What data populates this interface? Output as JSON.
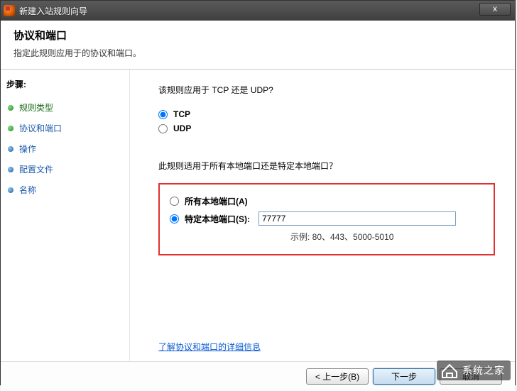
{
  "titlebar": {
    "text": "新建入站规则向导",
    "close": "x"
  },
  "header": {
    "title": "协议和端口",
    "subtitle": "指定此规则应用于的协议和端口。"
  },
  "sidebar": {
    "steps_label": "步骤:",
    "items": [
      {
        "label": "规则类型",
        "status": "completed"
      },
      {
        "label": "协议和端口",
        "status": "current"
      },
      {
        "label": "操作",
        "status": "pending"
      },
      {
        "label": "配置文件",
        "status": "pending"
      },
      {
        "label": "名称",
        "status": "pending"
      }
    ]
  },
  "content": {
    "protocol_question": "该规则应用于 TCP 还是 UDP?",
    "tcp_label": "TCP",
    "udp_label": "UDP",
    "protocol_selected": "tcp",
    "port_question": "此规则适用于所有本地端口还是特定本地端口？",
    "all_ports_label": "所有本地端口(A)",
    "specific_ports_label": "特定本地端口(S):",
    "port_selected": "specific",
    "port_value": "77777",
    "port_example": "示例: 80、443、5000-5010",
    "learn_link": "了解协议和端口的详细信息"
  },
  "footer": {
    "back": "< 上一步(B)",
    "next": "下一步",
    "cancel": "取消"
  },
  "watermark": {
    "text": "系统之家"
  }
}
